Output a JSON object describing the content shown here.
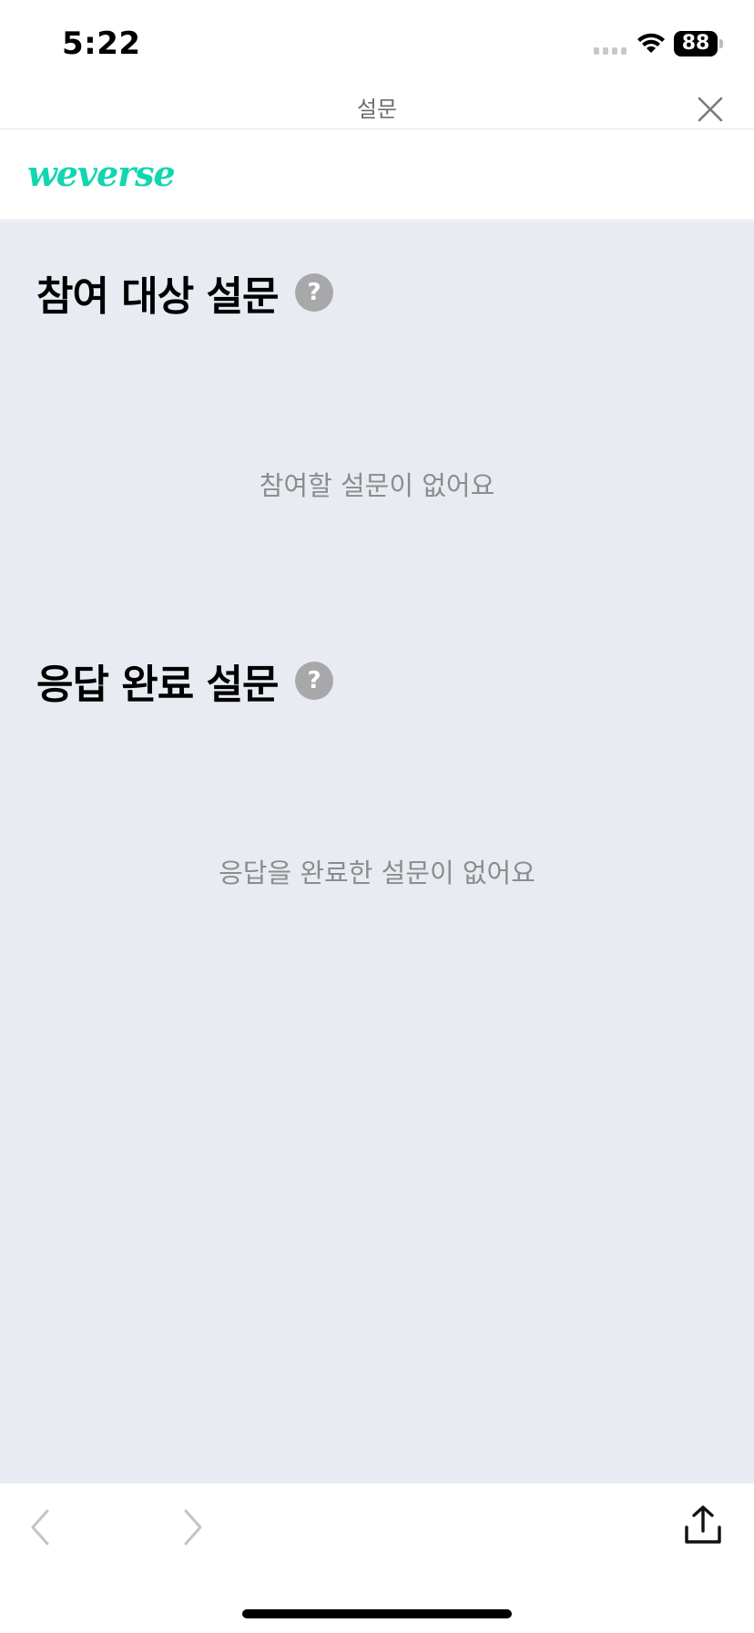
{
  "status_bar": {
    "time": "5:22",
    "battery": "88"
  },
  "nav": {
    "title": "설문"
  },
  "brand": {
    "logo_text": "weverse",
    "accent": "#11d6b0"
  },
  "sections": [
    {
      "title": "참여 대상 설문",
      "help_label": "?",
      "empty_message": "참여할 설문이 없어요"
    },
    {
      "title": "응답 완료 설문",
      "help_label": "?",
      "empty_message": "응답을 완료한 설문이 없어요"
    }
  ],
  "toolbar": {
    "icons": [
      "back-icon",
      "forward-icon",
      "share-icon"
    ]
  }
}
